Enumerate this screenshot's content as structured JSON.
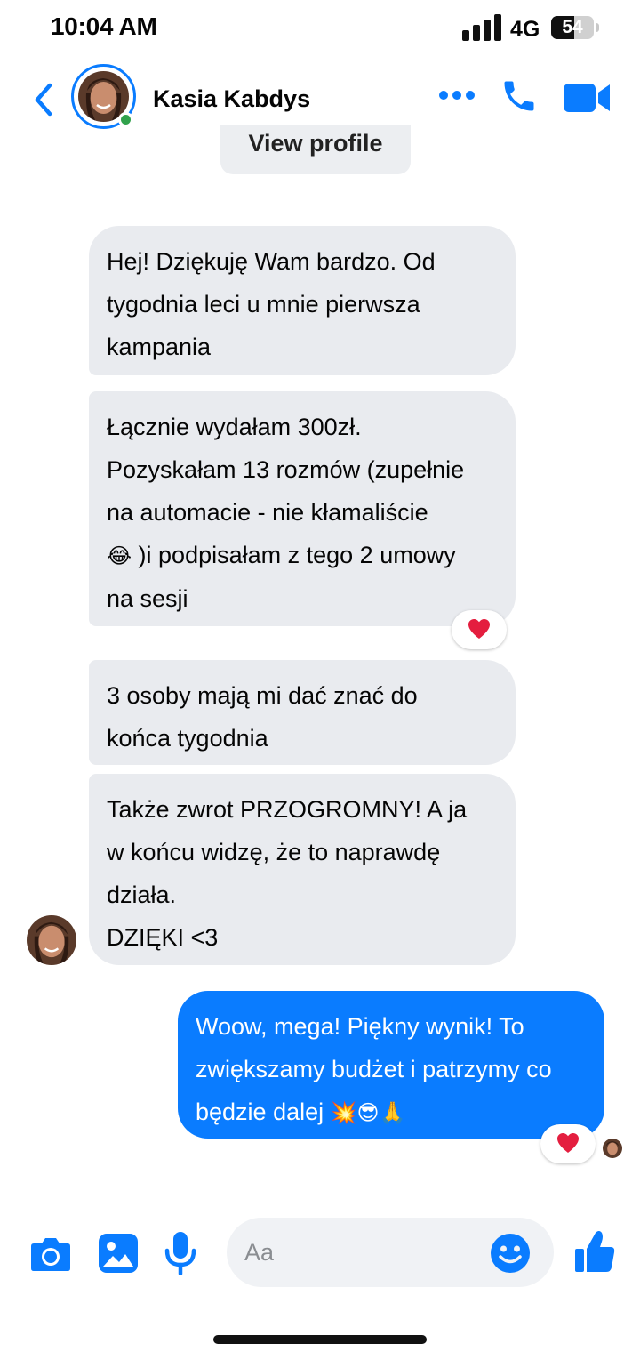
{
  "status_bar": {
    "time": "10:04 AM",
    "network": "4G",
    "battery_level": "54",
    "battery_fraction": 0.54
  },
  "header": {
    "contact_name": "Kasia Kabdys",
    "online": true,
    "icons": [
      "back-icon",
      "more-icon",
      "phone-call-icon",
      "video-call-icon"
    ]
  },
  "view_profile_label": "View profile",
  "messages": [
    {
      "sender": "contact",
      "text": "Hej! Dziękuję Wam bardzo. Od\ntygodnia leci u mnie pierwsza\nkampania"
    },
    {
      "sender": "contact",
      "text": "Łącznie wydałam 300zł.\nPozyskałam 13 rozmów (zupełnie\nna automacie - nie kłamaliście",
      "emoji": "😂",
      "text_after": " )i podpisałam z tego 2 umowy\nna sesji",
      "reaction": "heart"
    },
    {
      "sender": "contact",
      "text": "3 osoby mają mi dać znać do\nkońca tygodnia"
    },
    {
      "sender": "contact",
      "text": "Także zwrot PRZOGROMNY! A ja\nw końcu widzę, że to naprawdę\ndziała.\nDZIĘKI <3"
    },
    {
      "sender": "me",
      "text": "Woow, mega! Piękny wynik! To\nzwiększamy budżet i patrzymy co\nbędzie dalej ",
      "emoji": "💥😎🙏",
      "reaction": "heart"
    }
  ],
  "composer": {
    "placeholder": "Aa",
    "icons": [
      "camera-icon",
      "gallery-icon",
      "microphone-icon",
      "emoji-icon",
      "like-icon"
    ]
  },
  "colors": {
    "accent": "#0a7cff",
    "incoming_bubble": "#e9ebef",
    "online": "#31a24c",
    "heart": "#e41e3f"
  }
}
